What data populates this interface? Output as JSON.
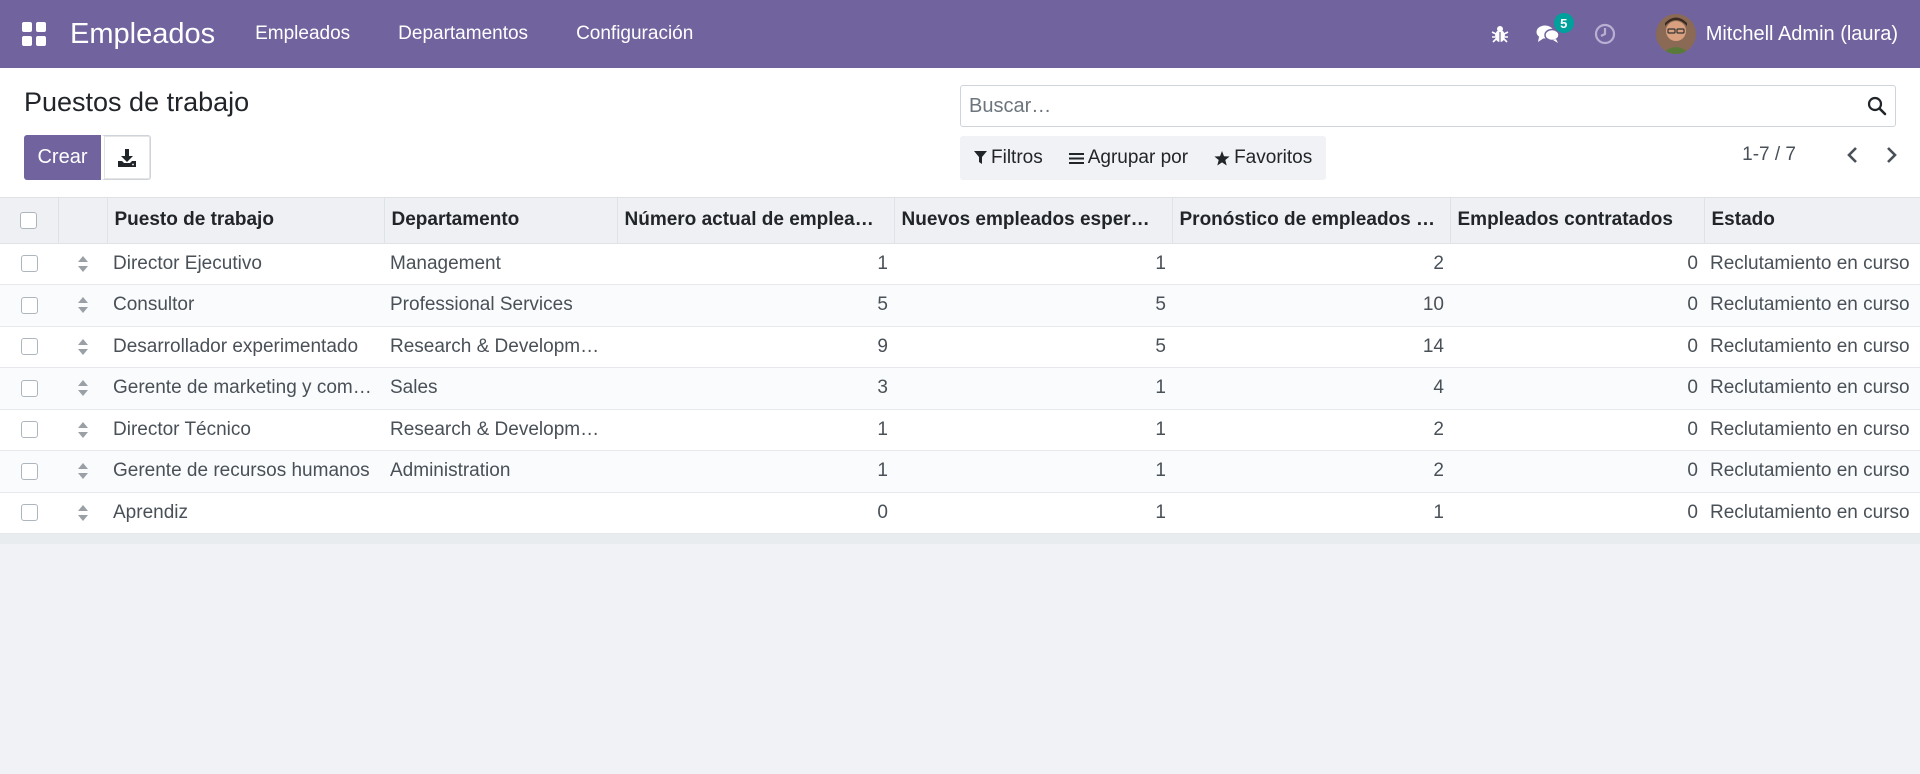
{
  "navbar": {
    "app_title": "Empleados",
    "menu": [
      "Empleados",
      "Departamentos",
      "Configuración"
    ],
    "messages_badge": "5",
    "user_name": "Mitchell Admin (laura)"
  },
  "control_panel": {
    "title": "Puestos de trabajo",
    "create_label": "Crear",
    "search_placeholder": "Buscar…",
    "filters_label": "Filtros",
    "group_by_label": "Agrupar por",
    "favorites_label": "Favoritos",
    "pager_value": "1-7 / 7"
  },
  "table": {
    "headers": [
      "Puesto de trabajo",
      "Departamento",
      "Número actual de emplea…",
      "Nuevos empleados esper…",
      "Pronóstico de empleados …",
      "Empleados contratados",
      "Estado"
    ],
    "rows": [
      {
        "job": "Director Ejecutivo",
        "dept": "Management",
        "current": "1",
        "expected": "1",
        "forecast": "2",
        "hired": "0",
        "state": "Reclutamiento en curso"
      },
      {
        "job": "Consultor",
        "dept": "Professional Services",
        "current": "5",
        "expected": "5",
        "forecast": "10",
        "hired": "0",
        "state": "Reclutamiento en curso"
      },
      {
        "job": "Desarrollador experimentado",
        "dept": "Research & Developm…",
        "current": "9",
        "expected": "5",
        "forecast": "14",
        "hired": "0",
        "state": "Reclutamiento en curso"
      },
      {
        "job": "Gerente de marketing y com…",
        "dept": "Sales",
        "current": "3",
        "expected": "1",
        "forecast": "4",
        "hired": "0",
        "state": "Reclutamiento en curso"
      },
      {
        "job": "Director Técnico",
        "dept": "Research & Developm…",
        "current": "1",
        "expected": "1",
        "forecast": "2",
        "hired": "0",
        "state": "Reclutamiento en curso"
      },
      {
        "job": "Gerente de recursos humanos",
        "dept": "Administration",
        "current": "1",
        "expected": "1",
        "forecast": "2",
        "hired": "0",
        "state": "Reclutamiento en curso"
      },
      {
        "job": "Aprendiz",
        "dept": "",
        "current": "0",
        "expected": "1",
        "forecast": "1",
        "hired": "0",
        "state": "Reclutamiento en curso"
      }
    ]
  },
  "icons": {
    "apps": "apps-grid-icon",
    "debug": "bug-icon",
    "messages": "chat-icon",
    "activities": "clock-icon",
    "download": "download-icon",
    "search": "search-icon",
    "filter": "filter-icon",
    "group": "list-icon",
    "favorite": "star-icon",
    "prev": "chevron-left-icon",
    "next": "chevron-right-icon",
    "handle": "drag-handle-icon"
  },
  "colors": {
    "brand": "#71639e",
    "badge": "#00a09d"
  }
}
